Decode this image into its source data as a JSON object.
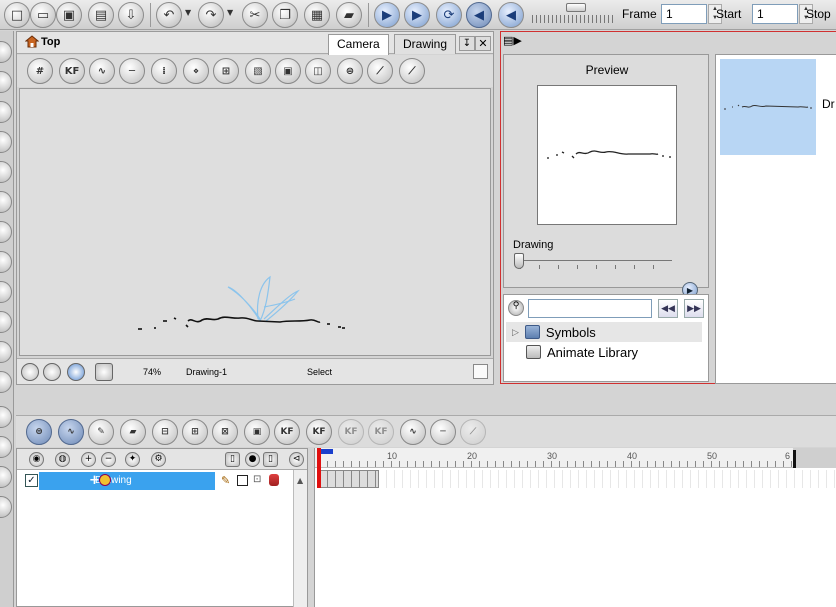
{
  "toolbar": {
    "frame_label": "Frame",
    "frame_value": "1",
    "start_label": "Start",
    "start_value": "1",
    "stop_label": "Stop"
  },
  "camera": {
    "title": "Top",
    "tabs": [
      "Camera",
      "Drawing"
    ],
    "zoom": "74%",
    "drawing": "Drawing-1",
    "mode": "Select"
  },
  "library": {
    "preview_title": "Preview",
    "drawing_label": "Drawing",
    "tree": [
      "Symbols",
      "Animate Library"
    ],
    "thumb_label": "Dr"
  },
  "timeline": {
    "ruler_numbers": [
      "10",
      "20",
      "30",
      "40",
      "50",
      "6"
    ],
    "layer_name": "Drawing",
    "layer_checked": "✓"
  },
  "colors": {
    "layer_selected": "#3aa2ee",
    "playhead": "#e01010",
    "thumb_selected": "#b8d6f4"
  }
}
